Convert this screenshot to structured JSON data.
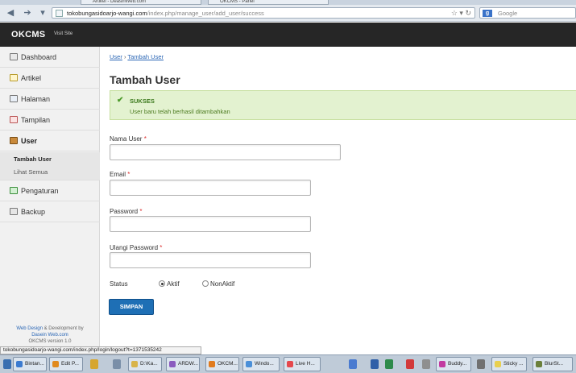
{
  "browser": {
    "tabs": [
      "Artikel - DeasinWeb.com",
      "OKCMS - Panel"
    ],
    "url_host": "tokobungasidoarjo-wangi.com",
    "url_path": "/index.php/manage_user/add_user/success",
    "search_placeholder": "Google",
    "status_url": "tokobungasidoarjo-wangi.com/index.php/login/logout?t=1371535242"
  },
  "app": {
    "brand": "OKCMS",
    "visit_site": "Visit Site"
  },
  "sidebar": {
    "items": [
      {
        "label": "Dashboard"
      },
      {
        "label": "Artikel"
      },
      {
        "label": "Halaman"
      },
      {
        "label": "Tampilan"
      },
      {
        "label": "User"
      },
      {
        "label": "Pengaturan"
      },
      {
        "label": "Backup"
      }
    ],
    "submenu": [
      "Tambah User",
      "Lihat Semua"
    ],
    "credit": {
      "line1_link": "Web Design",
      "line1_rest": "& Development by",
      "line2": "Dasein Web.com",
      "line3": "OKCMS version 1.0"
    }
  },
  "content": {
    "breadcrumb": [
      "User",
      "Tambah User"
    ],
    "breadcrumb_sep": "›",
    "title": "Tambah User",
    "alert": {
      "heading": "SUKSES",
      "message": "User baru telah berhasil ditambahkan"
    },
    "fields": {
      "username": {
        "label": "Nama User",
        "value": ""
      },
      "email": {
        "label": "Email",
        "value": ""
      },
      "password": {
        "label": "Password",
        "value": ""
      },
      "password_repeat": {
        "label": "Ulangi Password",
        "value": ""
      }
    },
    "required_mark": "*",
    "status": {
      "label": "Status",
      "options": [
        "Aktif",
        "NonAktif"
      ],
      "selected": "Aktif"
    },
    "submit_label": "SIMPAN"
  },
  "taskbar": {
    "tasks": [
      "Bintan...",
      "Edit P...",
      "D:\\Ka...",
      "ARDW...",
      "OKCM...",
      "Windo...",
      "Live H...",
      "Buddy...",
      "Sticky ...",
      "BlurSt..."
    ]
  },
  "colors": {
    "appbar": "#262626",
    "alert_bg": "#e3f2d0",
    "primary_button": "#1e6fb5",
    "link": "#2a66b5"
  }
}
